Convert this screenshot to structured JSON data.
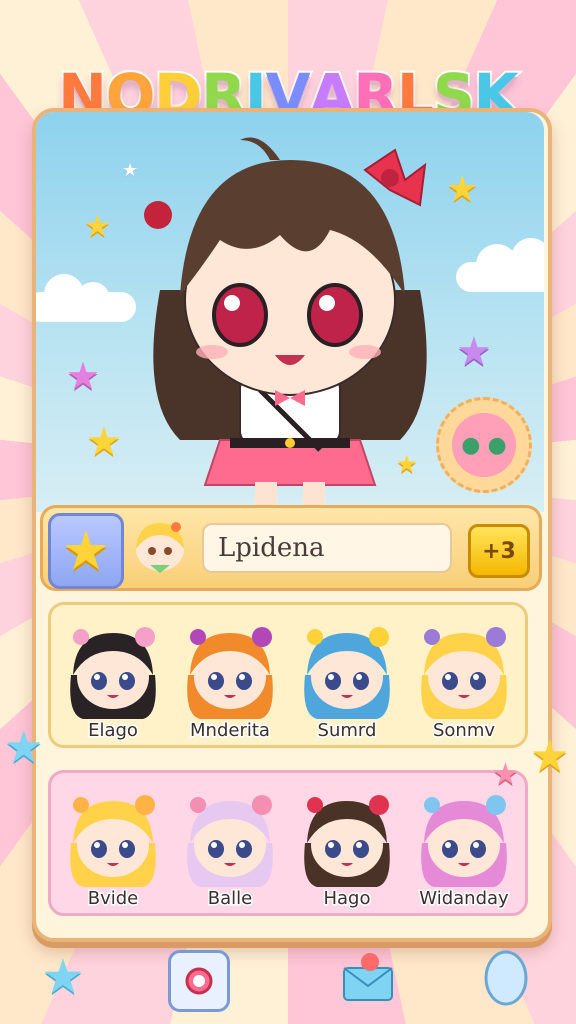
{
  "game": {
    "title_letters": [
      "N",
      "O",
      "D",
      "R",
      "I",
      "V",
      "A",
      "R",
      "L",
      "S",
      "K"
    ],
    "title_colors": [
      "#ff7a3c",
      "#ffa43a",
      "#ffcf3a",
      "#8fd94a",
      "#49c7e6",
      "#7b8cff",
      "#c77bff",
      "#ff6fb7",
      "#ff7a3c",
      "#8fd94a",
      "#49c7e6"
    ]
  },
  "selected": {
    "name": "Lpidena",
    "badge": "+3"
  },
  "characters_row1": [
    {
      "name": "Elago",
      "hair": "#2a2326",
      "accent": "#f4a0c8"
    },
    {
      "name": "Mnderita",
      "hair": "#f08a2a",
      "accent": "#b447b8"
    },
    {
      "name": "Sumrd",
      "hair": "#4fa6dd",
      "accent": "#ffd23a"
    },
    {
      "name": "Sonmv",
      "hair": "#ffd24a",
      "accent": "#9b7ad8"
    }
  ],
  "characters_row2": [
    {
      "name": "Bvide",
      "hair": "#ffd24a",
      "accent": "#ffb347"
    },
    {
      "name": "Balle",
      "hair": "#e7c8f0",
      "accent": "#f48fb1"
    },
    {
      "name": "Hago",
      "hair": "#4a3226",
      "accent": "#e0334f"
    },
    {
      "name": "Widanday",
      "hair": "#e58ad6",
      "accent": "#7ec6f0"
    }
  ],
  "icons": {
    "star_button": "star-icon",
    "bottom": [
      "star-icon",
      "search-icon",
      "mail-icon",
      "shield-icon"
    ]
  },
  "colors": {
    "frame": "#e9b37a",
    "row1_bg": "#fff2c9",
    "row2_bg": "#ffd7e6",
    "accent_yellow": "#ffd43b"
  }
}
